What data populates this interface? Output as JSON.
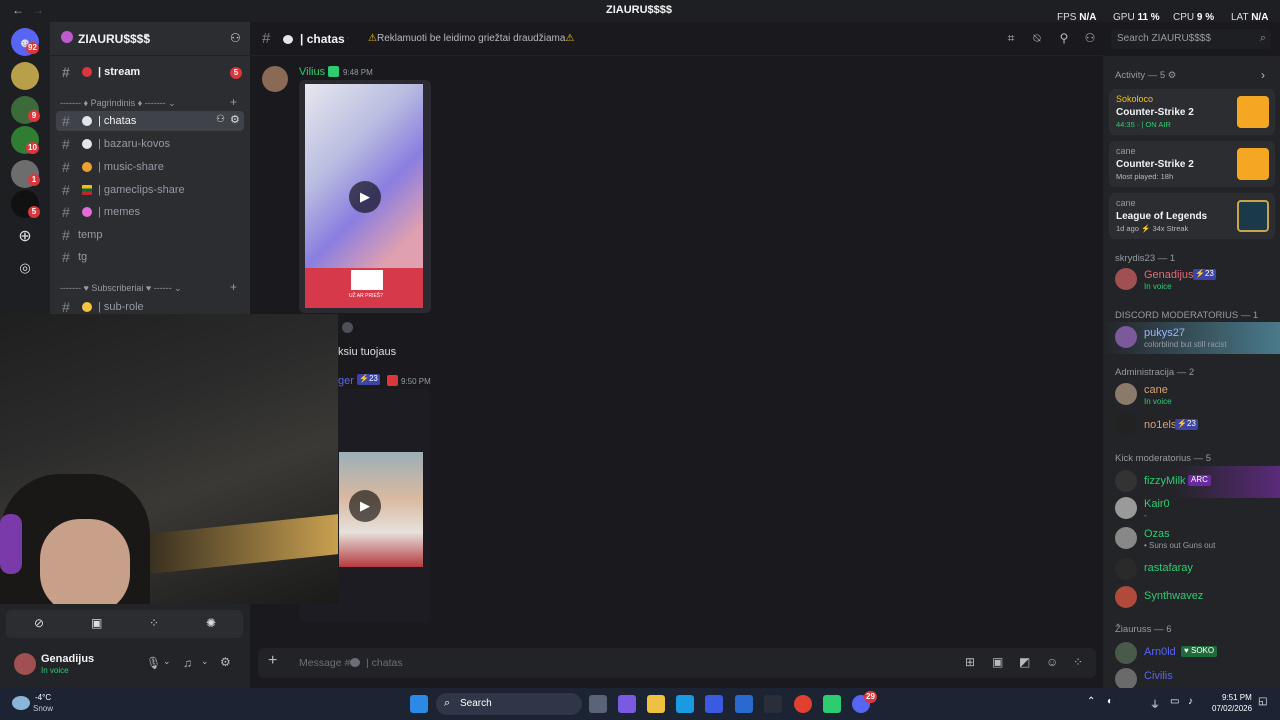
{
  "window": {
    "title": "ZIAURU$$$$",
    "back_glyph": "←",
    "fwd_glyph": "→"
  },
  "stats": {
    "fps_label": "FPS",
    "fps": "N/A",
    "gpu_label": "GPU",
    "gpu": "11 %",
    "cpu_label": "CPU",
    "cpu": "9 %",
    "lat_label": "LAT",
    "lat": "N/A"
  },
  "server_rail": {
    "badges": [
      "92",
      "9",
      "10",
      "1",
      "5"
    ]
  },
  "sidebar": {
    "server_name": "ZIAURU$$$$",
    "top_channel": {
      "label": "| stream",
      "badge": "5"
    },
    "categories": [
      "Pagrindinis",
      "Subscriberiai"
    ],
    "channels": [
      {
        "label": "| chatas",
        "icon": "speech"
      },
      {
        "label": "| bazaru-kovos",
        "icon": "speech"
      },
      {
        "label": "| music-share",
        "icon": "music"
      },
      {
        "label": "| gameclips-share",
        "icon": "flag"
      },
      {
        "label": "| memes",
        "icon": "memes"
      },
      {
        "label": "temp",
        "icon": ""
      },
      {
        "label": "tg",
        "icon": ""
      },
      {
        "label": "| sub-role",
        "icon": "heart"
      }
    ]
  },
  "header": {
    "channel_name": "| chatas",
    "topic": "Reklamuoti be leidimo griežtai draudžiama",
    "search_placeholder": "Search ZIAURU$$$$"
  },
  "messages": [
    {
      "author": "Vilius",
      "time": "9:48 PM",
      "author_color": "#2ecc71"
    },
    {
      "text_fragment": "ksiu tuojaus"
    },
    {
      "author_fragment": "ger",
      "badge": "23",
      "time": "9:50 PM",
      "author_color": "#5865f2"
    }
  ],
  "video_overlays": {
    "qr_caption": "UŽ AR PRIEŠ?"
  },
  "composer": {
    "placeholder": "Message #",
    "channel": "| chatas"
  },
  "user": {
    "name": "Genadijus",
    "status": "In voice"
  },
  "activity": {
    "header": "Activity — 5",
    "cards": [
      {
        "user": "Sokoloco",
        "game": "Counter-Strike 2",
        "detail": "44:35  ·  | ON AIR",
        "user_color": "#f0c419"
      },
      {
        "user": "cane",
        "game": "Counter-Strike 2",
        "detail": "Most played: 18h",
        "user_color": "#949ba4"
      },
      {
        "user": "cane",
        "game": "League of Legends",
        "detail": "1d ago  ⚡ 34x Streak",
        "user_color": "#949ba4"
      }
    ]
  },
  "member_groups": [
    {
      "title": "skrydis23 — 1",
      "members": [
        {
          "name": "Genadijus",
          "badge": "23",
          "sub": "In voice",
          "color": "#e06c75"
        }
      ]
    },
    {
      "title": "DISCORD MODERATORIUS — 1",
      "members": [
        {
          "name": "pukys27",
          "sub": "colorblind but still racist",
          "color": "#9bb6ff"
        }
      ]
    },
    {
      "title": "Administracija — 2",
      "members": [
        {
          "name": "cane",
          "sub": "In voice",
          "color": "#d4a373"
        },
        {
          "name": "no1els",
          "badge": "23",
          "sub": "",
          "color": "#d4a373"
        }
      ]
    },
    {
      "title": "Kick moderatorius — 5",
      "members": [
        {
          "name": "fizzyMilk",
          "badge": "ARC",
          "sub": "",
          "color": "#2ecc71"
        },
        {
          "name": "Kair0",
          "sub": "-",
          "color": "#2ecc71"
        },
        {
          "name": "Ozas",
          "sub": "• Suns out Guns out",
          "color": "#2ecc71"
        },
        {
          "name": "rastafaray",
          "sub": "",
          "color": "#2ecc71"
        },
        {
          "name": "Synthwavez",
          "sub": "",
          "color": "#2ecc71"
        }
      ]
    },
    {
      "title": "Žiauruss — 6",
      "members": [
        {
          "name": "Arn0ld",
          "badge": "SOKO",
          "sub": "",
          "color": "#5865f2"
        },
        {
          "name": "Civilis",
          "sub": "",
          "color": "#5865f2"
        }
      ]
    }
  ],
  "taskbar": {
    "weather_temp": "-4°C",
    "weather_desc": "Snow",
    "search_label": "Search",
    "time": "9:51 PM",
    "date": "07/02/2026",
    "discord_badge": "29"
  }
}
